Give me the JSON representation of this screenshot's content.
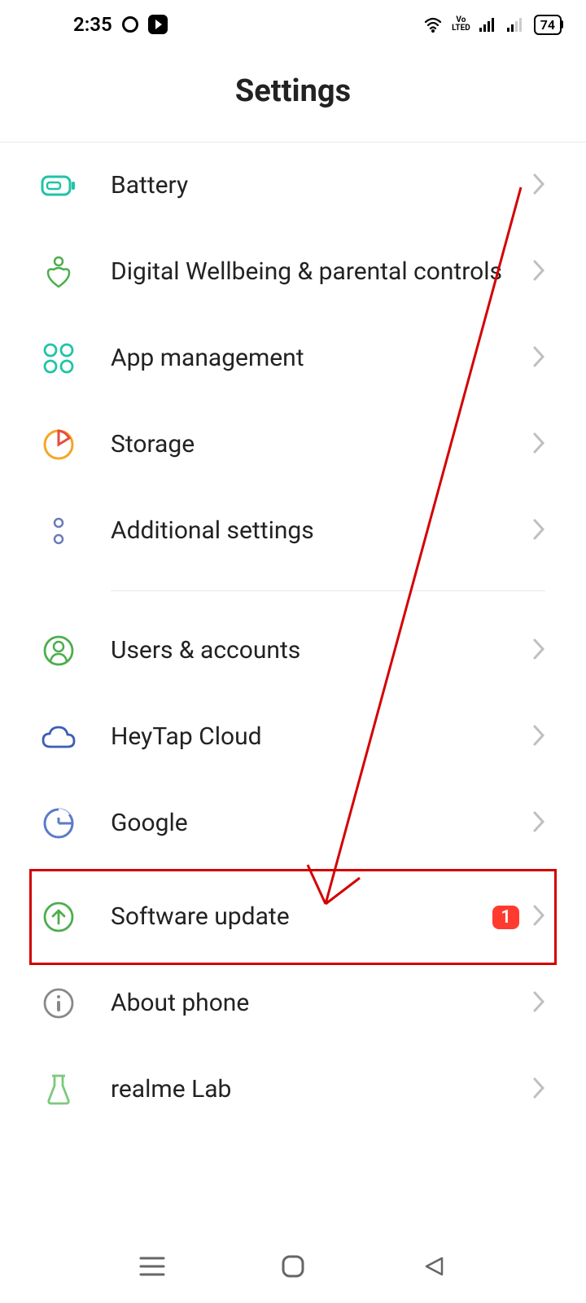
{
  "statusBar": {
    "time": "2:35",
    "battery": "74",
    "volte": "Vo\nLTED"
  },
  "header": {
    "title": "Settings"
  },
  "rows": {
    "battery": {
      "label": "Battery"
    },
    "wellbeing": {
      "label": "Digital Wellbeing & parental controls"
    },
    "appmgmt": {
      "label": "App management"
    },
    "storage": {
      "label": "Storage"
    },
    "additional": {
      "label": "Additional settings"
    },
    "users": {
      "label": "Users & accounts"
    },
    "heytap": {
      "label": "HeyTap Cloud"
    },
    "google": {
      "label": "Google"
    },
    "software": {
      "label": "Software update",
      "badge": "1"
    },
    "about": {
      "label": "About phone"
    },
    "realme": {
      "label": "realme Lab"
    }
  },
  "annotation": {
    "highlights": "software-update-row",
    "type": "red-arrow-and-box"
  }
}
